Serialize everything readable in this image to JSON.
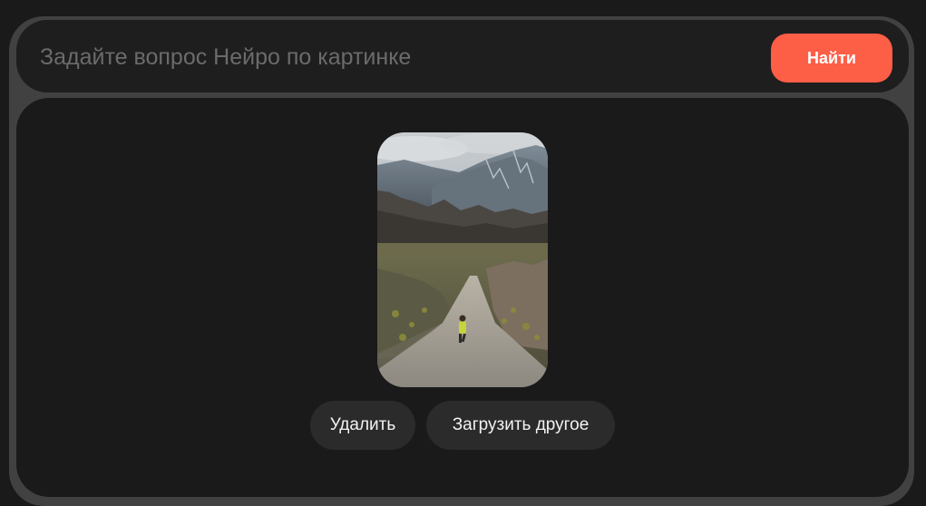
{
  "search": {
    "placeholder": "Задайте вопрос Нейро по картинке",
    "value": "",
    "find_label": "Найти"
  },
  "image": {
    "alt": "Человек бежит по дороге к горам",
    "subject_icon": "landscape-photo"
  },
  "actions": {
    "delete_label": "Удалить",
    "upload_label": "Загрузить другое"
  },
  "colors": {
    "accent": "#fd5e46",
    "panel": "#1a1a1b",
    "frame": "#414142",
    "button": "#2b2b2c"
  }
}
